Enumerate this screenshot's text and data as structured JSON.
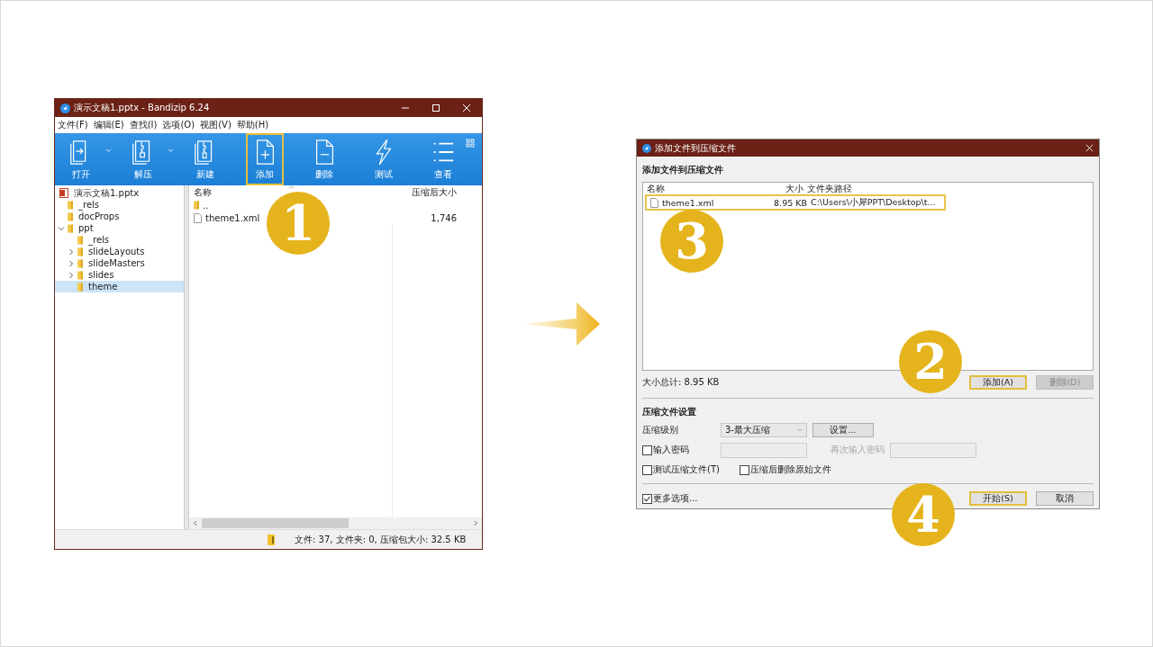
{
  "bandizip_window": {
    "title": "演示文稿1.pptx - Bandizip 6.24",
    "menu": [
      "文件(F)",
      "编辑(E)",
      "查找(I)",
      "选项(O)",
      "视图(V)",
      "帮助(H)"
    ],
    "toolbar": [
      {
        "label": "打开",
        "kind": "open",
        "dropdown": true,
        "highlighted": false
      },
      {
        "label": "解压",
        "kind": "extract",
        "dropdown": true,
        "highlighted": false
      },
      {
        "label": "新建",
        "kind": "new",
        "dropdown": false,
        "highlighted": false
      },
      {
        "label": "添加",
        "kind": "add",
        "dropdown": false,
        "highlighted": true
      },
      {
        "label": "删除",
        "kind": "delete",
        "dropdown": false,
        "highlighted": false
      },
      {
        "label": "测试",
        "kind": "test",
        "dropdown": false,
        "highlighted": false
      },
      {
        "label": "查看",
        "kind": "view",
        "dropdown": false,
        "highlighted": false
      }
    ],
    "tree": [
      {
        "label": "演示文稿1.pptx",
        "kind": "archive",
        "selected": false,
        "children": [
          {
            "label": "_rels",
            "kind": "folder",
            "selected": false
          },
          {
            "label": "docProps",
            "kind": "folder",
            "selected": false
          },
          {
            "label": "ppt",
            "kind": "folder",
            "selected": false,
            "expanded": true,
            "children": [
              {
                "label": "_rels",
                "kind": "folder",
                "selected": false
              },
              {
                "label": "slideLayouts",
                "kind": "folder",
                "selected": false,
                "expanded": false
              },
              {
                "label": "slideMasters",
                "kind": "folder",
                "selected": false,
                "expanded": false
              },
              {
                "label": "slides",
                "kind": "folder",
                "selected": false,
                "expanded": false
              },
              {
                "label": "theme",
                "kind": "folder",
                "selected": true
              }
            ]
          }
        ]
      }
    ],
    "file_list": {
      "columns": [
        "名称",
        "压缩后大小"
      ],
      "rows": [
        {
          "name": "..",
          "kind": "folder"
        },
        {
          "name": "theme1.xml",
          "kind": "file",
          "size": "1,746"
        }
      ]
    },
    "status_bar": "文件: 37, 文件夹: 0, 压缩包大小: 32.5 KB"
  },
  "add_dialog": {
    "title": "添加文件到压缩文件",
    "heading": "添加文件到压缩文件",
    "file_list": {
      "columns": [
        "名称",
        "大小",
        "文件夹路径"
      ],
      "rows": [
        {
          "name": "theme1.xml",
          "size": "8.95 KB",
          "path": "C:\\Users\\小犀PPT\\Desktop\\t...",
          "highlighted": true
        }
      ]
    },
    "total": "大小总计: 8.95 KB",
    "list_buttons": [
      {
        "label": "添加(A)",
        "disabled": false,
        "highlighted": true
      },
      {
        "label": "删除(D)",
        "disabled": true,
        "highlighted": false
      }
    ],
    "settings_heading": "压缩文件设置",
    "level_label": "压缩级别",
    "level_value": "3-最大压缩",
    "settings_button": "设置...",
    "password": {
      "label": "输入密码",
      "checked": false,
      "field_disabled": true
    },
    "confirm_password": {
      "label": "再次输入密码",
      "disabled": true
    },
    "options": [
      {
        "label": "测试压缩文件(T)",
        "checked": false
      },
      {
        "label": "压缩后删除原始文件",
        "checked": false
      }
    ],
    "more_options": {
      "label": "更多选项...",
      "checked": true
    },
    "footer_buttons": [
      {
        "label": "开始(S)",
        "highlighted": true
      },
      {
        "label": "取消",
        "highlighted": false
      }
    ]
  },
  "step_markers": [
    {
      "label": "1"
    },
    {
      "label": "3"
    },
    {
      "label": "2"
    },
    {
      "label": "4"
    }
  ]
}
